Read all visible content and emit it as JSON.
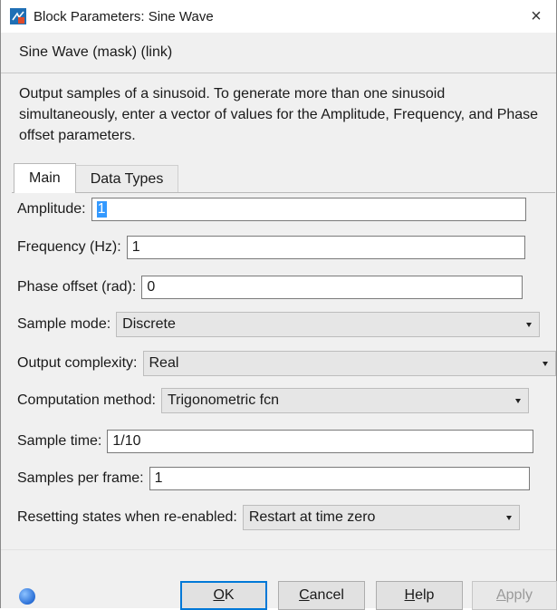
{
  "window": {
    "title": "Block Parameters: Sine Wave",
    "close_glyph": "×"
  },
  "mask": {
    "label": "Sine Wave (mask) (link)",
    "description": "Output samples of a sinusoid.  To generate more than one sinusoid simultaneously, enter a vector of values for the Amplitude, Frequency, and Phase offset parameters."
  },
  "tabs": [
    {
      "label": "Main",
      "active": true
    },
    {
      "label": "Data Types",
      "active": false
    }
  ],
  "fields": {
    "amplitude": {
      "label": "Amplitude:",
      "value": "1"
    },
    "frequency": {
      "label": "Frequency (Hz):",
      "value": "1"
    },
    "phase": {
      "label": "Phase offset (rad):",
      "value": "0"
    },
    "sample_mode": {
      "label": "Sample mode:",
      "value": "Discrete"
    },
    "output_complexity": {
      "label": "Output complexity:",
      "value": "Real"
    },
    "computation_method": {
      "label": "Computation method:",
      "value": "Trigonometric fcn"
    },
    "sample_time": {
      "label": "Sample time:",
      "value": "1/10"
    },
    "samples_per_frame": {
      "label": "Samples per frame:",
      "value": "1"
    },
    "resetting_states": {
      "label": "Resetting states when re-enabled:",
      "value": "Restart at time zero"
    }
  },
  "buttons": {
    "ok": {
      "mnemonic": "O",
      "rest": "K"
    },
    "cancel": {
      "mnemonic": "C",
      "rest": "ancel"
    },
    "help": {
      "mnemonic": "H",
      "rest": "elp"
    },
    "apply": {
      "mnemonic": "A",
      "rest": "pply",
      "enabled": false
    }
  },
  "icons": {
    "app": "simulink-block-icon",
    "help": "help-icon"
  },
  "colors": {
    "selection": "#3399ff",
    "ok_focus": "#0078d7"
  }
}
